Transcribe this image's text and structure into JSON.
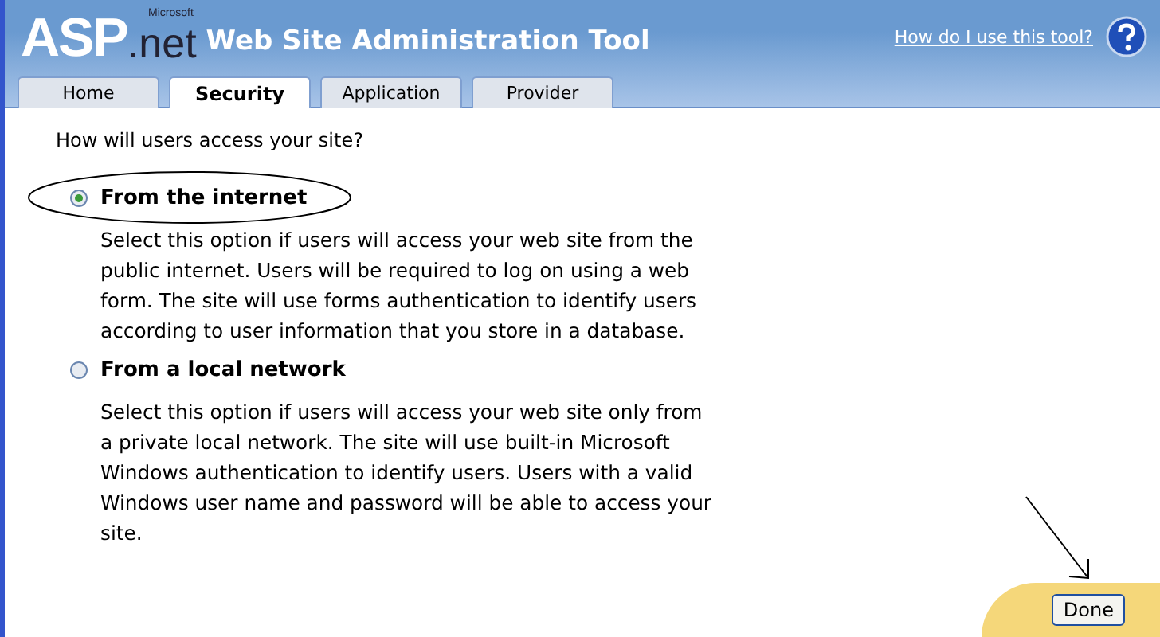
{
  "header": {
    "logo_main": "ASP",
    "logo_net": ".net",
    "logo_small": "Microsoft",
    "title": "Web Site Administration Tool",
    "help_link": "How do I use this tool?"
  },
  "tabs": [
    {
      "label": "Home",
      "selected": false
    },
    {
      "label": "Security",
      "selected": true
    },
    {
      "label": "Application",
      "selected": false
    },
    {
      "label": "Provider",
      "selected": false
    }
  ],
  "question": "How will users access your site?",
  "options": [
    {
      "label": "From the internet",
      "selected": true,
      "highlighted": true,
      "description": "Select this option if users will access your web site from the public internet. Users will be required to log on using a web form. The site will use forms authentication to identify users according to user information that you store in a database."
    },
    {
      "label": "From a local network",
      "selected": false,
      "highlighted": false,
      "description": "Select this option if users will access your web site only from a private local network. The site will use built-in Microsoft Windows authentication to identify users. Users with a valid Windows user name and password will be able to access your site."
    }
  ],
  "footer": {
    "button": "Done",
    "arrow": true
  }
}
